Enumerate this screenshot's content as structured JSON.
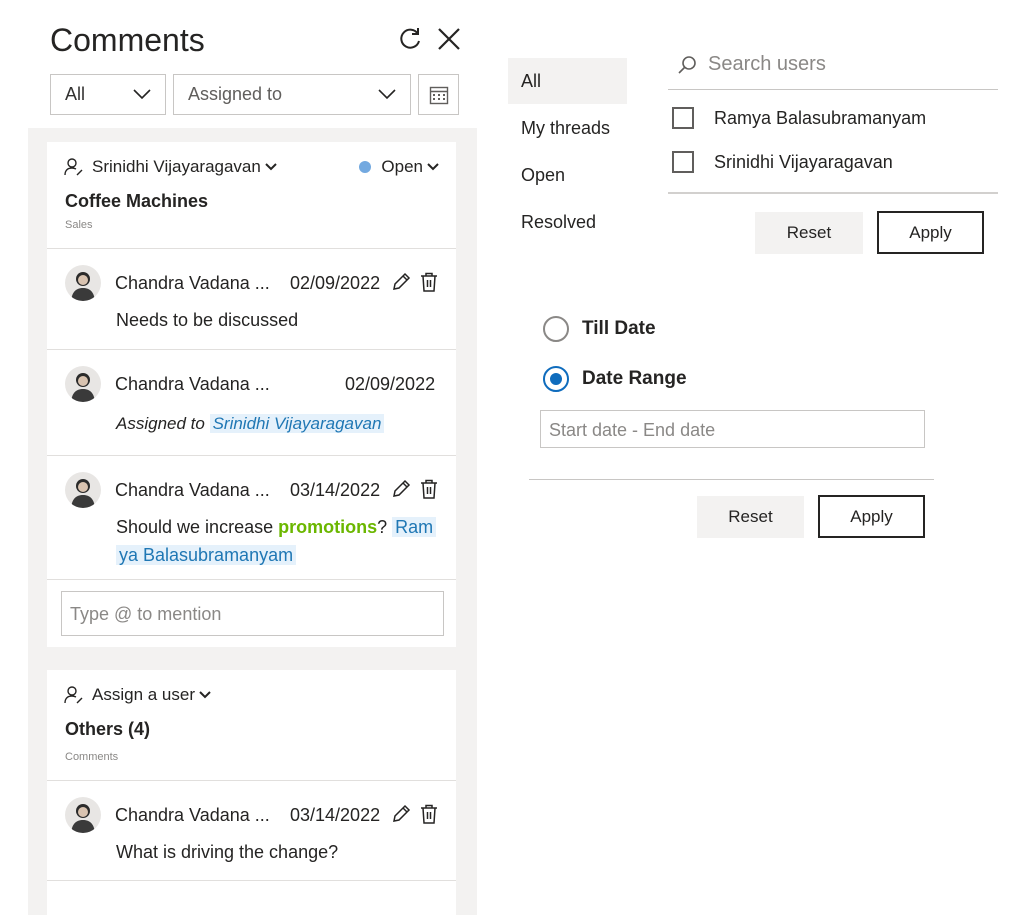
{
  "pane": {
    "title": "Comments",
    "filters": {
      "view": "All",
      "assigned": "Assigned to"
    }
  },
  "threads": [
    {
      "assignee": "Srinidhi Vijayaragavan",
      "status": "Open",
      "status_color": "#73a9e0",
      "title": "Coffee Machines",
      "subtitle": "Sales",
      "comments": [
        {
          "author": "Chandra Vadana ...",
          "date": "02/09/2022",
          "text": "Needs to be discussed"
        },
        {
          "author": "Chandra Vadana ...",
          "date": "02/09/2022",
          "assigned_prefix": "Assigned to",
          "assigned_user": "Srinidhi Vijayaragavan"
        },
        {
          "author": "Chandra Vadana ...",
          "date": "03/14/2022",
          "text_before": "Should we increase ",
          "keyword": "promotions",
          "text_after": "? ",
          "mention_line1": "Ram",
          "mention_line2": "ya Balasubramanyam"
        }
      ],
      "mention_placeholder": "Type @ to mention"
    },
    {
      "assignee": "Assign a user",
      "title": "Others (4)",
      "subtitle": "Comments",
      "comments": [
        {
          "author": "Chandra Vadana ...",
          "date": "03/14/2022",
          "text": "What is driving the change?"
        }
      ]
    }
  ],
  "thread_filter": {
    "items": [
      "All",
      "My threads",
      "Open",
      "Resolved"
    ],
    "selected": "All"
  },
  "user_filter": {
    "search_placeholder": "Search users",
    "users": [
      "Ramya Balasubramanyam",
      "Srinidhi Vijayaragavan"
    ],
    "reset_label": "Reset",
    "apply_label": "Apply"
  },
  "date_filter": {
    "options": [
      "Till Date",
      "Date Range"
    ],
    "selected": "Date Range",
    "range_placeholder": "Start date - End date",
    "reset_label": "Reset",
    "apply_label": "Apply"
  },
  "colors": {
    "accent": "#0f6cbd",
    "mention_bg": "#e5f1fb",
    "mention_text": "#1f77b4",
    "keyword": "#6bb700"
  }
}
